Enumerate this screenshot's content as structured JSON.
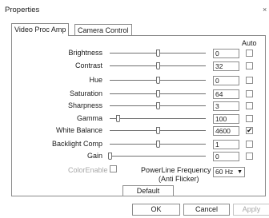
{
  "window": {
    "title": "Properties",
    "close": "×"
  },
  "tabs": [
    {
      "label": "Video Proc Amp",
      "active": true
    },
    {
      "label": "Camera Control",
      "active": false
    }
  ],
  "auto_header": "Auto",
  "properties": [
    {
      "label": "Brightness",
      "value": "0",
      "slider_fraction": 0.5,
      "auto": false
    },
    {
      "label": "Contrast",
      "value": "32",
      "slider_fraction": 0.5,
      "auto": false
    },
    {
      "label": "Hue",
      "value": "0",
      "slider_fraction": 0.5,
      "auto": false
    },
    {
      "label": "Saturation",
      "value": "64",
      "slider_fraction": 0.5,
      "auto": false
    },
    {
      "label": "Sharpness",
      "value": "3",
      "slider_fraction": 0.5,
      "auto": false
    },
    {
      "label": "Gamma",
      "value": "100",
      "slider_fraction": 0.08,
      "auto": false
    },
    {
      "label": "White Balance",
      "value": "4600",
      "slider_fraction": 0.5,
      "auto": true
    },
    {
      "label": "Backlight Comp",
      "value": "1",
      "slider_fraction": 0.5,
      "auto": false
    },
    {
      "label": "Gain",
      "value": "0",
      "slider_fraction": 0.0,
      "auto": false
    }
  ],
  "color_enable": {
    "label": "ColorEnable",
    "checked": false,
    "enabled": false
  },
  "powerline": {
    "label_line1": "PowerLine Frequency",
    "label_line2": "(Anti Flicker)",
    "value": "60 Hz"
  },
  "buttons": {
    "default": "Default",
    "ok": "OK",
    "cancel": "Cancel",
    "apply": "Apply"
  }
}
